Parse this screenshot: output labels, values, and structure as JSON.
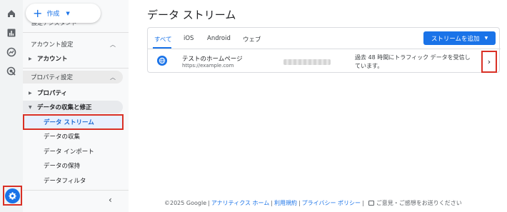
{
  "create": {
    "label": "作成"
  },
  "sidebar": {
    "partial_top": "設定アシスタント",
    "account_section": "アカウント設定",
    "account_item": "アカウント",
    "property_section": "プロパティ設定",
    "property_item": "プロパティ",
    "data_collection_section": "データの収集と修正",
    "sub_items": [
      "データ ストリーム",
      "データの収集",
      "データ インポート",
      "データの保持",
      "データフィルタ"
    ]
  },
  "main": {
    "title": "データ ストリーム",
    "tabs": [
      "すべて",
      "iOS",
      "Android",
      "ウェブ"
    ],
    "add_stream_label": "ストリームを追加",
    "stream": {
      "name": "テストのホームページ",
      "url": "https://example.com",
      "status_line1": "過去 48 時間にトラフィック データを受信し",
      "status_line2": "ています。"
    }
  },
  "footer": {
    "copyright": "©2025 Google",
    "links": [
      "アナリティクス ホーム",
      "利用規約",
      "プライバシー ポリシー"
    ],
    "feedback": "ご意見・ご感想をお送りください"
  },
  "colors": {
    "accent": "#1a73e8",
    "highlight": "#d93025"
  },
  "icons": [
    "home-icon",
    "reports-icon",
    "explore-icon",
    "advertising-icon",
    "admin-gear-icon",
    "globe-icon"
  ]
}
